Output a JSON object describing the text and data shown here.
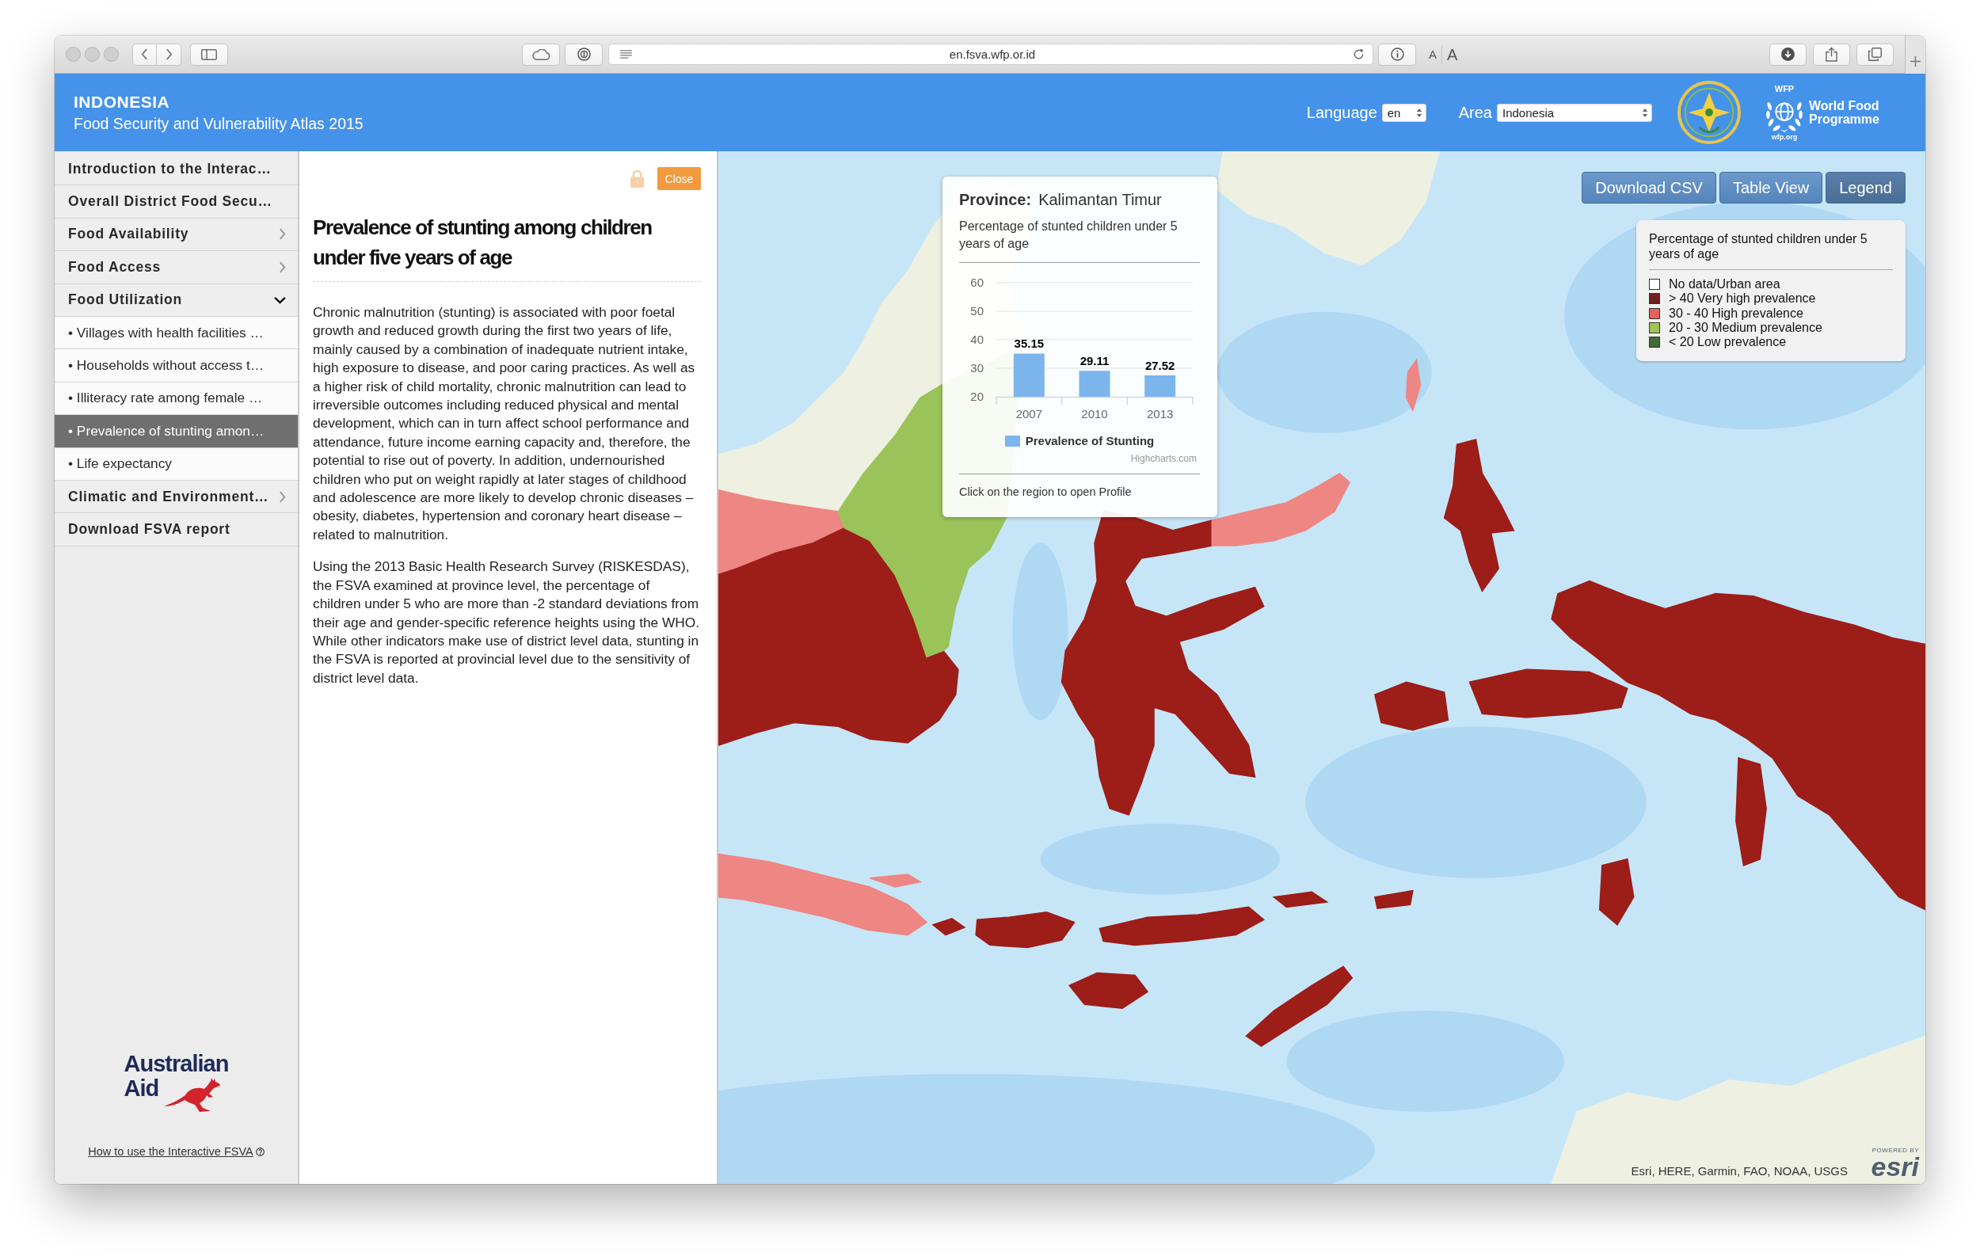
{
  "browser": {
    "url": "en.fsva.wfp.or.id",
    "text_size_buttons": [
      "A",
      "A"
    ]
  },
  "header": {
    "title": "INDONESIA",
    "subtitle": "Food Security and Vulnerability Atlas 2015",
    "language": {
      "label": "Language",
      "value": "en"
    },
    "area": {
      "label": "Area",
      "value": "Indonesia"
    },
    "wfp_logo": {
      "acronym": "WFP",
      "name": "World Food Programme",
      "url": "wfp.org"
    }
  },
  "sidebar": {
    "items": [
      {
        "kind": "page",
        "label": "Introduction to the Interac…",
        "selected": false
      },
      {
        "kind": "page",
        "label": "Overall District Food Secu…",
        "selected": false
      },
      {
        "kind": "group",
        "label": "Food Availability",
        "expanded": false,
        "selected": false
      },
      {
        "kind": "group",
        "label": "Food Access",
        "expanded": false,
        "selected": false
      },
      {
        "kind": "group",
        "label": "Food Utilization",
        "expanded": true,
        "selected": false,
        "children": [
          {
            "label": "• Villages with health facilities …",
            "selected": false
          },
          {
            "label": "• Households without access t…",
            "selected": false
          },
          {
            "label": "• Illiteracy rate among female …",
            "selected": false
          },
          {
            "label": "• Prevalence of stunting amon…",
            "selected": true
          },
          {
            "label": "• Life expectancy",
            "selected": false
          }
        ]
      },
      {
        "kind": "group",
        "label": "Climatic and Environment…",
        "expanded": false,
        "selected": false
      },
      {
        "kind": "page",
        "label": "Download FSVA report",
        "selected": false
      }
    ],
    "sponsor_logo": {
      "line_1": "Australian",
      "line_2": "Aid"
    },
    "help_link": "How to use the Interactive FSVA"
  },
  "article": {
    "close_button": "Close",
    "title": "Prevalence of stunting among children under five years of age",
    "paragraphs": [
      "Chronic malnutrition (stunting) is associated with poor foetal growth and reduced growth during the first two years of life, mainly caused by a combination of inadequate nutrient intake, high exposure to disease, and poor caring practices. As well as a higher risk of child mortality, chronic malnutrition can lead to irreversible outcomes including reduced physical and mental development, which can in turn affect school performance and attendance, future income earning capacity and, therefore, the potential to rise out of poverty. In addition, undernourished children who put on weight rapidly at later stages of childhood and adolescence are more likely to develop chronic diseases – obesity, diabetes, hypertension and coronary heart disease – related to malnutrition.",
      "Using the 2013 Basic Health Research Survey (RISKESDAS), the FSVA examined at province level, the percentage of children under 5 who are more than -2 standard deviations from their age and gender-specific reference heights using the WHO. While other indicators make use of district level data, stunting in the FSVA is reported at provincial level due to the sensitivity of district level data."
    ]
  },
  "map": {
    "buttons": [
      {
        "label": "Download CSV",
        "active": false
      },
      {
        "label": "Table View",
        "active": false
      },
      {
        "label": "Legend",
        "active": true
      }
    ],
    "legend": {
      "title": "Percentage of stunted children under 5 years of age",
      "items": [
        {
          "label": "No data/Urban area",
          "color": "#ffffff"
        },
        {
          "label": "> 40 Very high prevalence",
          "color": "#6e1f1f"
        },
        {
          "label": "30 - 40 High prevalence",
          "color": "#e26262"
        },
        {
          "label": "20 - 30 Medium prevalence",
          "color": "#9dc455"
        },
        {
          "label": "< 20 Low prevalence",
          "color": "#3e6b36"
        }
      ]
    },
    "popup": {
      "label": "Province:",
      "value": "Kalimantan Timur",
      "description": "Percentage of stunted children under 5 years of age",
      "chart_data": {
        "type": "bar",
        "categories": [
          "2007",
          "2010",
          "2013"
        ],
        "series": [
          {
            "name": "Prevalence of Stunting",
            "color": "#7cb5ec",
            "values": [
              35.15,
              29.11,
              27.52
            ]
          }
        ],
        "ylim": [
          20,
          60
        ],
        "yticks": [
          20,
          30,
          40,
          50,
          60
        ],
        "grid": true,
        "data_labels": true
      },
      "credit": "Highcharts.com",
      "footer": "Click on the region to open Profile"
    },
    "attribution": "Esri, HERE, Garmin, FAO, NOAA, USGS",
    "esri_logo": {
      "caption": "POWERED BY",
      "wordmark": "esri"
    }
  }
}
